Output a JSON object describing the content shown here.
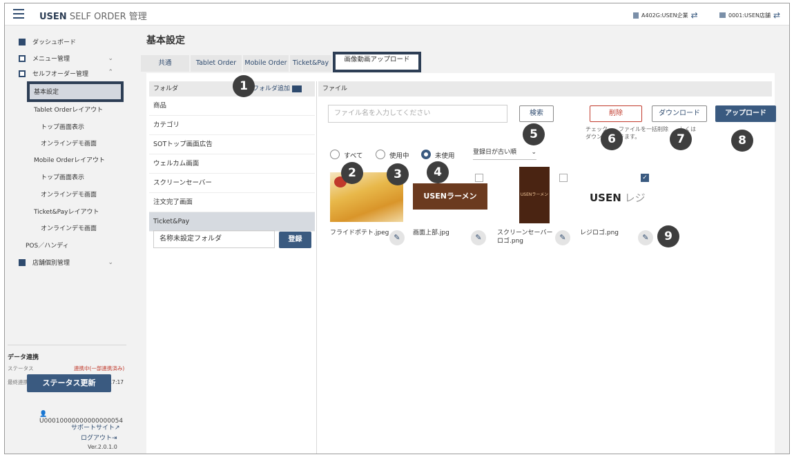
{
  "app": {
    "brand_bold": "USEN",
    "brand_rest": "SELF ORDER 管理"
  },
  "header": {
    "company": "A402G:USEN企業",
    "store": "0001:USEN店舗"
  },
  "sidebar": {
    "items": [
      {
        "label": "ダッシュボード"
      },
      {
        "label": "メニュー管理"
      },
      {
        "label": "セルフオーダー管理"
      },
      {
        "label": "基本設定"
      },
      {
        "label": "Tablet Orderレイアウト"
      },
      {
        "label": "トップ画面表示"
      },
      {
        "label": "オンラインデモ画面"
      },
      {
        "label": "Mobile Orderレイアウト"
      },
      {
        "label": "トップ画面表示"
      },
      {
        "label": "オンラインデモ画面"
      },
      {
        "label": "Ticket&Payレイアウト"
      },
      {
        "label": "オンラインデモ画面"
      },
      {
        "label": "POS／ハンディ"
      },
      {
        "label": "店舗個別管理"
      }
    ],
    "sync_title": "データ連携",
    "status_label": "ステータス",
    "status_value": "連携中(一部連携済み)",
    "last_label": "最終連携日時",
    "last_value": "2026年01月06日(火) 17:17",
    "status_button": "ステータス更新",
    "user_id": "U00010000000000000054",
    "support": "サポートサイト",
    "logout": "ログアウト",
    "version": "Ver.2.0.1.0"
  },
  "main": {
    "title": "基本設定",
    "tabs": [
      "共通",
      "Tablet Order",
      "Mobile Order",
      "Ticket&Pay",
      "画像動画アップロード"
    ],
    "folder_header": "フォルダ",
    "folder_add": "フォルダ追加",
    "file_header": "ファイル",
    "folders": [
      "商品",
      "カテゴリ",
      "SOTトップ画面広告",
      "ウェルカム画面",
      "スクリーンセーバー",
      "注文完了画面",
      "Ticket&Pay"
    ],
    "new_folder_value": "名称未設定フォルダ",
    "register_button": "登録",
    "search_placeholder": "ファイル名を入力してください",
    "search_button": "検索",
    "delete_button": "削除",
    "download_button": "ダウンロード",
    "upload_button": "アップロード",
    "bulk_note_line1": "チェック　　ファイルを一括削除　　しくは",
    "bulk_note_line2": "ダウン　　　きます。",
    "filters": [
      "すべて",
      "使用中",
      "未使用"
    ],
    "sort_value": "登録日が古い順",
    "files": [
      {
        "name": "フライドポテト.jpeg",
        "checked": false
      },
      {
        "name": "画面上部.jpg",
        "checked": false
      },
      {
        "name_line1": "スクリーンセーバー",
        "name_line2": "ロゴ.png",
        "checked": false
      },
      {
        "name": "レジロゴ.png",
        "checked": true
      }
    ],
    "logo_text_bold": "USEN",
    "logo_text_rest": "レジ",
    "ramen_text": "USENラーメン",
    "small_logo": "USENラーメン"
  },
  "badges": [
    "1",
    "2",
    "3",
    "4",
    "5",
    "6",
    "7",
    "8",
    "9"
  ],
  "colors": {
    "accent": "#3a5a80",
    "highlight": "#2d3e55",
    "danger": "#c0392b"
  }
}
